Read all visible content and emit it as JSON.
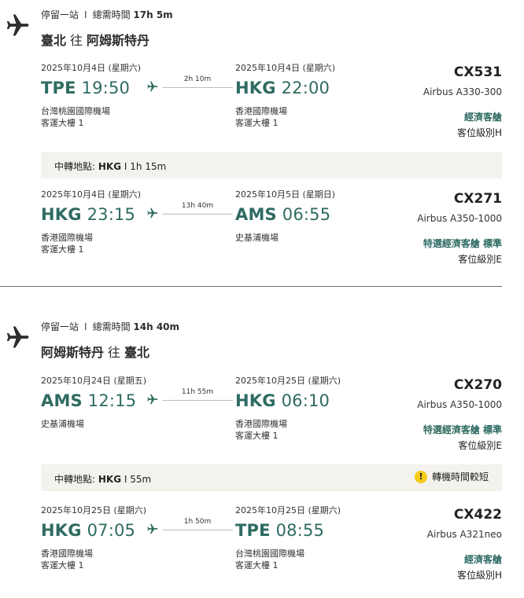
{
  "journeys": [
    {
      "stops_label": "停留一站",
      "separator": "I",
      "duration_label": "總需時間",
      "duration": "17h 5m",
      "origin_city": "臺北",
      "to_word": "往",
      "dest_city": "阿姆斯特丹",
      "segments": [
        {
          "dep_date": "2025年10月4日 (星期六)",
          "arr_date": "2025年10月4日 (星期六)",
          "dep_code": "TPE",
          "dep_time": "19:50",
          "arr_code": "HKG",
          "arr_time": "22:00",
          "duration": "2h 10m",
          "dep_airport": "台灣桃園國際機場",
          "dep_terminal": "客運大樓 1",
          "arr_airport": "香港國際機場",
          "arr_terminal": "客運大樓 1",
          "flight": "CX531",
          "aircraft": "Airbus A330-300",
          "cabin": "經濟客艙",
          "fare_class": "客位級別H"
        },
        {
          "dep_date": "2025年10月4日 (星期六)",
          "arr_date": "2025年10月5日 (星期日)",
          "dep_code": "HKG",
          "dep_time": "23:15",
          "arr_code": "AMS",
          "arr_time": "06:55",
          "duration": "13h 40m",
          "dep_airport": "香港國際機場",
          "dep_terminal": "客運大樓 1",
          "arr_airport": "史基浦機場",
          "arr_terminal": "",
          "flight": "CX271",
          "aircraft": "Airbus A350-1000",
          "cabin": "特選經濟客艙 標準",
          "fare_class": "客位級別E"
        }
      ],
      "connection": {
        "label": "中轉地點:",
        "airport": "HKG",
        "separator": "I",
        "time": "1h 15m",
        "warning": ""
      }
    },
    {
      "stops_label": "停留一站",
      "separator": "I",
      "duration_label": "總需時間",
      "duration": "14h 40m",
      "origin_city": "阿姆斯特丹",
      "to_word": "往",
      "dest_city": "臺北",
      "segments": [
        {
          "dep_date": "2025年10月24日 (星期五)",
          "arr_date": "2025年10月25日 (星期六)",
          "dep_code": "AMS",
          "dep_time": "12:15",
          "arr_code": "HKG",
          "arr_time": "06:10",
          "duration": "11h 55m",
          "dep_airport": "史基浦機場",
          "dep_terminal": "",
          "arr_airport": "香港國際機場",
          "arr_terminal": "客運大樓 1",
          "flight": "CX270",
          "aircraft": "Airbus A350-1000",
          "cabin": "特選經濟客艙 標準",
          "fare_class": "客位級別E"
        },
        {
          "dep_date": "2025年10月25日 (星期六)",
          "arr_date": "2025年10月25日 (星期六)",
          "dep_code": "HKG",
          "dep_time": "07:05",
          "arr_code": "TPE",
          "arr_time": "08:55",
          "duration": "1h 50m",
          "dep_airport": "香港國際機場",
          "dep_terminal": "客運大樓 1",
          "arr_airport": "台灣桃園國際機場",
          "arr_terminal": "客運大樓 1",
          "flight": "CX422",
          "aircraft": "Airbus A321neo",
          "cabin": "經濟客艙",
          "fare_class": "客位級別H"
        }
      ],
      "connection": {
        "label": "中轉地點:",
        "airport": "HKG",
        "separator": "I",
        "time": "55m",
        "warning": "轉機時間較短",
        "warning_icon": "!"
      }
    }
  ],
  "colors": {
    "accent": "#2e6b62",
    "connection_bg": "#f4f2ec",
    "warning": "#f5cc1a"
  }
}
